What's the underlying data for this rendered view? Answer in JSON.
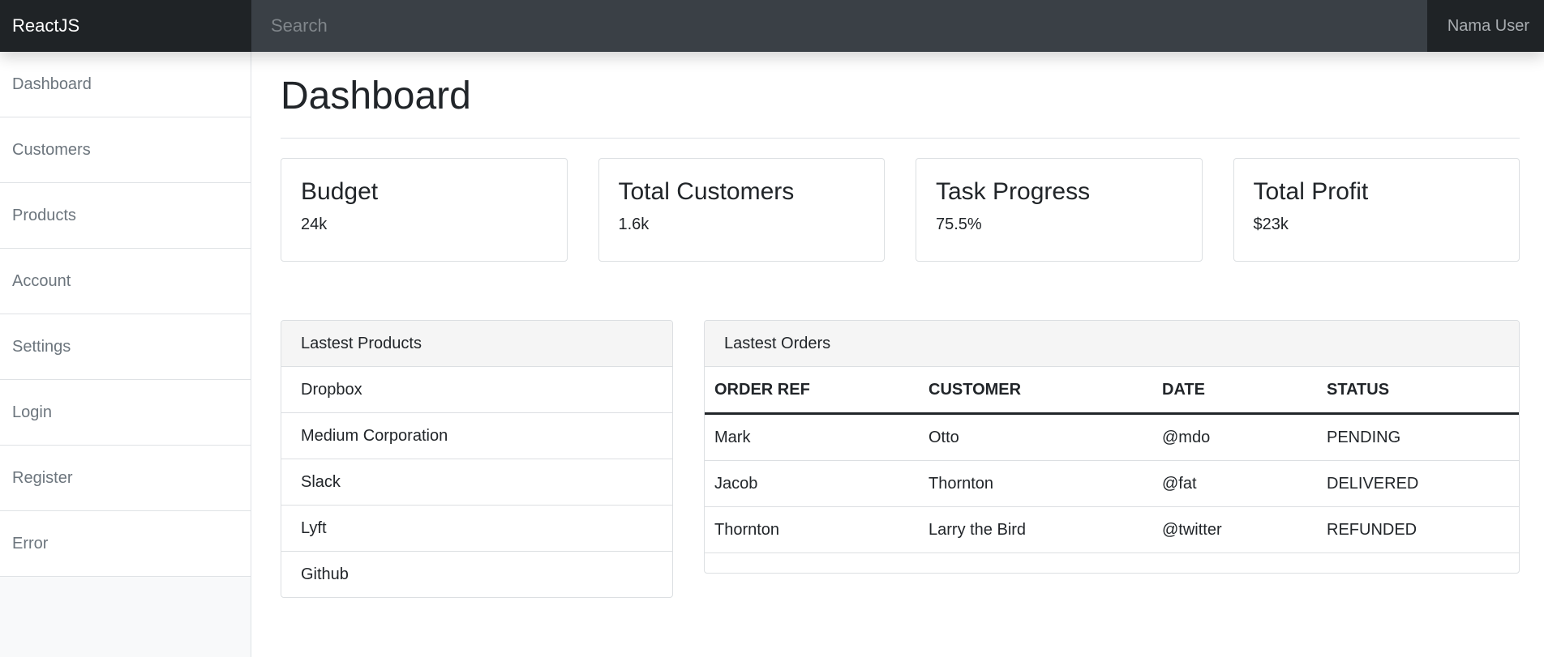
{
  "header": {
    "brand": "ReactJS",
    "search_placeholder": "Search",
    "user_name": "Nama User"
  },
  "sidebar": {
    "items": [
      {
        "label": "Dashboard"
      },
      {
        "label": "Customers"
      },
      {
        "label": "Products"
      },
      {
        "label": "Account"
      },
      {
        "label": "Settings"
      },
      {
        "label": "Login"
      },
      {
        "label": "Register"
      },
      {
        "label": "Error"
      }
    ]
  },
  "main": {
    "title": "Dashboard",
    "cards": [
      {
        "title": "Budget",
        "value": "24k"
      },
      {
        "title": "Total Customers",
        "value": "1.6k"
      },
      {
        "title": "Task Progress",
        "value": "75.5%"
      },
      {
        "title": "Total Profit",
        "value": "$23k"
      }
    ],
    "products": {
      "heading": "Lastest Products",
      "items": [
        "Dropbox",
        "Medium Corporation",
        "Slack",
        "Lyft",
        "Github"
      ]
    },
    "orders": {
      "heading": "Lastest Orders",
      "columns": [
        "ORDER REF",
        "CUSTOMER",
        "DATE",
        "STATUS"
      ],
      "rows": [
        [
          "Mark",
          "Otto",
          "@mdo",
          "PENDING"
        ],
        [
          "Jacob",
          "Thornton",
          "@fat",
          "DELIVERED"
        ],
        [
          "Thornton",
          "Larry the Bird",
          "@twitter",
          "REFUNDED"
        ]
      ]
    }
  }
}
